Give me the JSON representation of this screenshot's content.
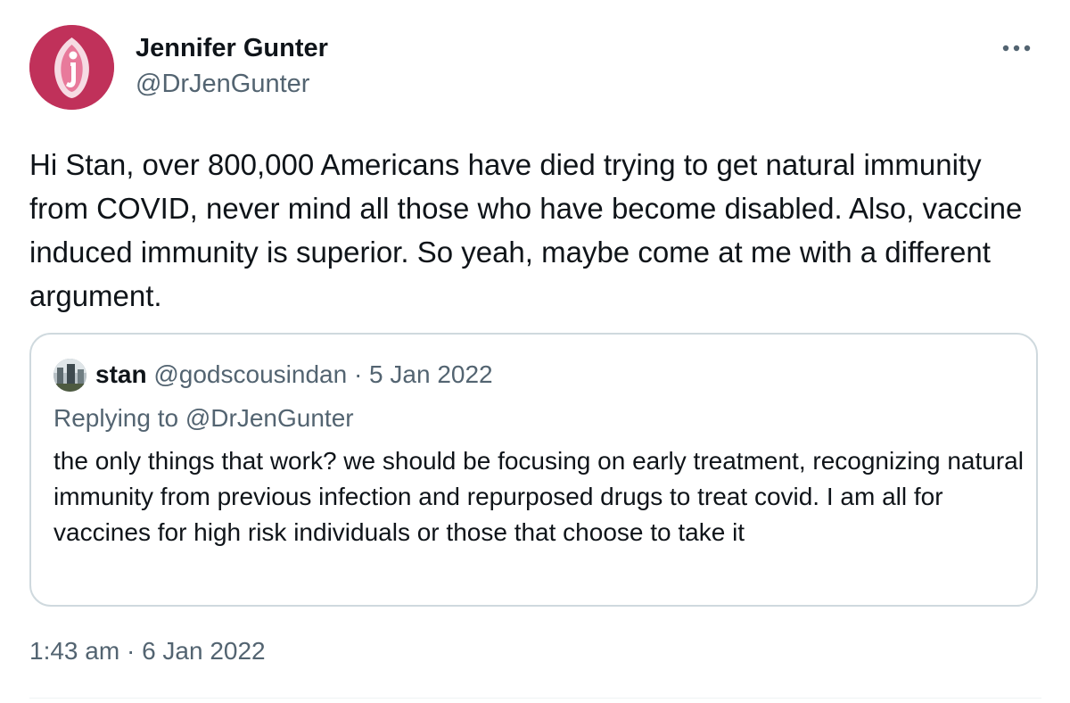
{
  "author": {
    "name": "Jennifer Gunter",
    "handle": "@DrJenGunter",
    "avatar_color": "#c0315a"
  },
  "tweet": {
    "text": "Hi Stan, over 800,000 Americans have died trying to get natural immunity from COVID, never mind all those who have become disabled. Also, vaccine induced immunity is superior. So yeah, maybe come at me with a different argument.",
    "time": "1:43 am",
    "separator": "·",
    "date": "6 Jan 2022",
    "more_icon": "more-horizontal-icon"
  },
  "quoted": {
    "name": "stan",
    "handle": "@godscousindan",
    "separator": "·",
    "date": "5 Jan 2022",
    "replying_prefix": "Replying to",
    "replying_to": "@DrJenGunter",
    "text": "the only things that work? we should be focusing on early treatment, recognizing natural immunity from previous infection and repurposed drugs to treat covid. I am all for vaccines for high risk individuals or those that choose to take it"
  },
  "colors": {
    "text_primary": "#0f1419",
    "text_secondary": "#536471",
    "border": "#cfd9de"
  }
}
